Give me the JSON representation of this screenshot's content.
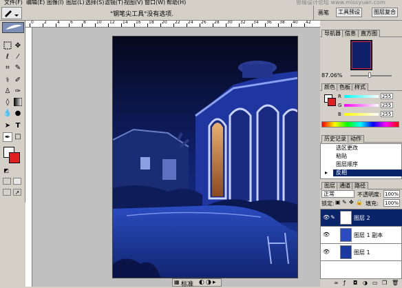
{
  "menu": {
    "items": [
      "文件(F)",
      "编辑(E)",
      "图像(I)",
      "图层(L)",
      "选择(S)",
      "滤镜(T)",
      "视图(V)",
      "窗口(W)",
      "帮助(H)"
    ],
    "watermark": "思缘设计论坛  www.missyuan.com"
  },
  "options_bar": {
    "hint": "\"钢笔尖工具\"没有选项.",
    "palette_tab": "画笔",
    "presets_tab": "工具预设",
    "layer_comps_tab": "图层复合"
  },
  "ruler": {
    "ticks": [
      "0",
      "2",
      "4",
      "6",
      "8",
      "10",
      "12",
      "14",
      "16",
      "18",
      "20",
      "22",
      "24",
      "26",
      "28",
      "30",
      "32",
      "34",
      "36",
      "38",
      "40",
      "42"
    ]
  },
  "toolbox": {
    "tools": [
      "marquee-tool",
      "move-tool",
      "lasso-tool",
      "magic-wand-tool",
      "crop-tool",
      "slice-tool",
      "healing-brush-tool",
      "brush-tool",
      "clone-stamp-tool",
      "history-brush-tool",
      "eraser-tool",
      "gradient-tool",
      "blur-tool",
      "dodge-tool",
      "path-selection-tool",
      "type-tool",
      "pen-tool",
      "shape-tool",
      "notes-tool",
      "eyedropper-tool",
      "hand-tool",
      "zoom-tool"
    ],
    "foreground_color": "#ffffff",
    "background_color": "#e02020"
  },
  "navigator": {
    "tabs": [
      "导航器",
      "信息",
      "直方图"
    ],
    "zoom": "87.06%"
  },
  "color_panel": {
    "tabs": [
      "颜色",
      "色板",
      "样式"
    ],
    "r_label": "R",
    "r_value": "255",
    "g_label": "G",
    "g_value": "255",
    "b_label": "B",
    "b_value": "255"
  },
  "history_panel": {
    "tabs": [
      "历史记录",
      "动作"
    ],
    "items": [
      "选区更改",
      "粘贴",
      "图层顺序",
      "反相"
    ],
    "selected_index": 3
  },
  "layers_panel": {
    "tabs": [
      "图层",
      "通道",
      "路径"
    ],
    "blend_mode": "正常",
    "opacity_label": "不透明度:",
    "opacity_value": "100%",
    "lock_label": "锁定:",
    "fill_label": "填充:",
    "fill_value": "100%",
    "layers": [
      "图层 2",
      "图层 1 副本",
      "图层 1"
    ],
    "selected_index": 0
  },
  "document": {
    "status": "标准"
  }
}
